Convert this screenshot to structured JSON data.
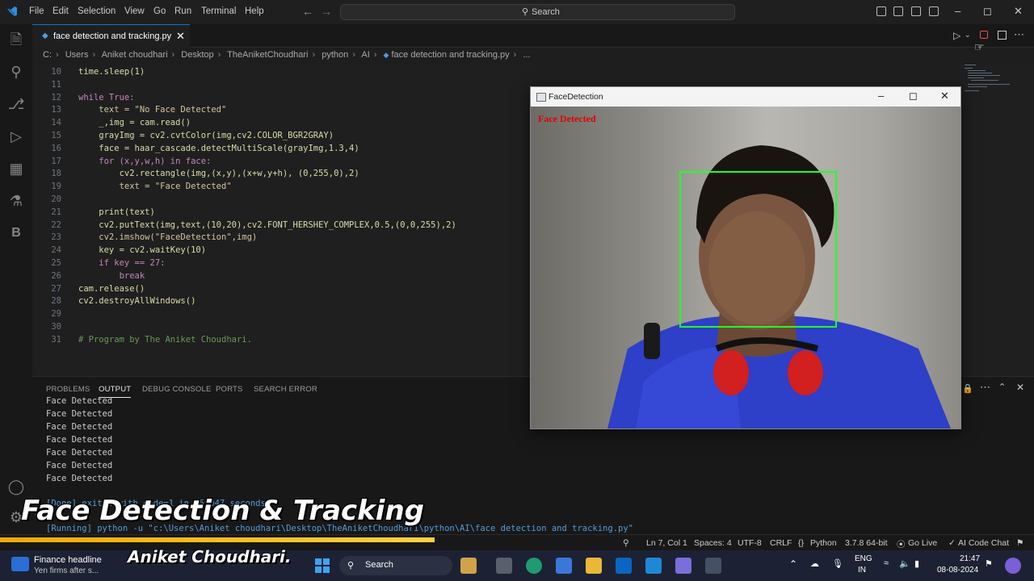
{
  "titlebar": {
    "menus": [
      "File",
      "Edit",
      "Selection",
      "View",
      "Go",
      "Run",
      "Terminal",
      "Help"
    ],
    "search_label": "Search"
  },
  "tab": {
    "label": "face detection and tracking.py"
  },
  "breadcrumb": [
    "C:",
    "Users",
    "Aniket choudhari",
    "Desktop",
    "TheAniketChoudhari",
    "python",
    "AI",
    "face detection and tracking.py",
    "..."
  ],
  "editor": {
    "line_numbers": [
      "10",
      "11",
      "12",
      "13",
      "14",
      "15",
      "16",
      "17",
      "18",
      "19",
      "20",
      "21",
      "22",
      "23",
      "24",
      "25",
      "26",
      "27",
      "28",
      "29",
      "30",
      "31"
    ],
    "lines": [
      "time.sleep(1)",
      "",
      "while True:",
      "    text = \"No Face Detected\"",
      "    _,img = cam.read()",
      "    grayImg = cv2.cvtColor(img,cv2.COLOR_BGR2GRAY)",
      "    face = haar_cascade.detectMultiScale(grayImg,1.3,4)",
      "    for (x,y,w,h) in face:",
      "        cv2.rectangle(img,(x,y),(x+w,y+h), (0,255,0),2)",
      "        text = \"Face Detected\"",
      "",
      "    print(text)",
      "    cv2.putText(img,text,(10,20),cv2.FONT_HERSHEY_COMPLEX,0.5,(0,0,255),2)",
      "    cv2.imshow(\"FaceDetection\",img)",
      "    key = cv2.waitKey(10)",
      "    if key == 27:",
      "        break",
      "cam.release()",
      "cv2.destroyAllWindows()",
      "",
      "",
      "# Program by The Aniket Choudhari."
    ]
  },
  "panel": {
    "tabs": [
      "PROBLEMS",
      "OUTPUT",
      "DEBUG CONSOLE",
      "PORTS",
      "SEARCH ERROR"
    ],
    "active_tab": "OUTPUT",
    "output_lines": [
      "Face Detected",
      "Face Detected",
      "Face Detected",
      "Face Detected",
      "Face Detected",
      "Face Detected",
      "Face Detected"
    ],
    "done_line": "[Done] exited with code=1 in 45.047 seconds",
    "running_line": "[Running] python -u \"c:\\Users\\Aniket choudhari\\Desktop\\TheAniketChoudhari\\python\\AI\\face detection and tracking.py\""
  },
  "face_window": {
    "title": "FaceDetection",
    "overlay_text": "Face Detected",
    "box_color": "#22ff22",
    "text_color": "#e00000"
  },
  "statusbar": {
    "position": "Ln 7, Col 1",
    "spaces": "Spaces: 4",
    "encoding": "UTF-8",
    "eol": "CRLF",
    "language": "Python",
    "interpreter": "3.7.8 64-bit",
    "golive": "Go Live",
    "ai": "AI Code Chat"
  },
  "taskbar": {
    "news_title": "Finance headline",
    "news_sub": "Yen firms after s...",
    "search": "Search",
    "lang1": "ENG",
    "lang2": "IN",
    "time": "21:47",
    "date": "08-08-2024"
  },
  "captions": {
    "title": "Face Detection & Tracking",
    "author": "Aniket Choudhari."
  },
  "colors": {
    "accent": "#0078d4",
    "editor_bg": "#1f1f1f",
    "caption_bar": "#f2a900"
  }
}
